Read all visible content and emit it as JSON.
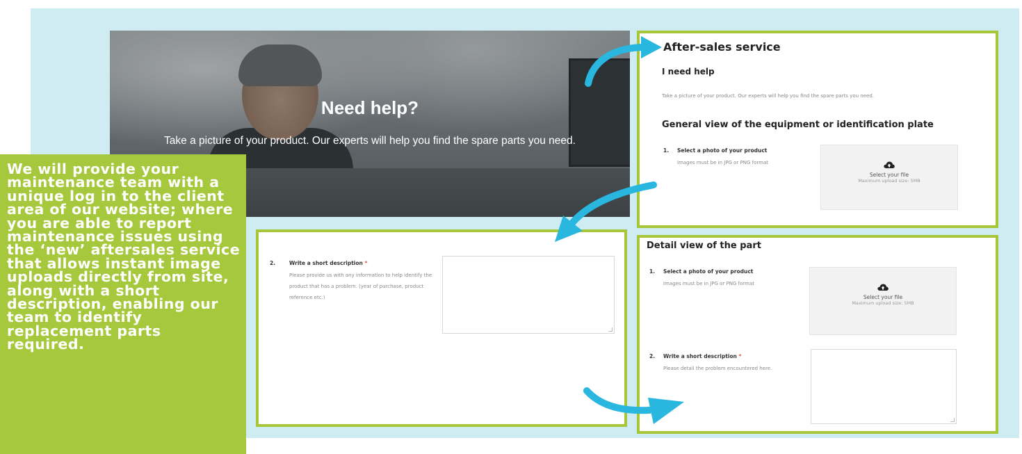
{
  "hero": {
    "title": "Need help?",
    "subtitle": "Take a picture of your product. Our experts will help you find the spare parts you need."
  },
  "panel_top": {
    "title": "After-sales service",
    "subtitle": "I need help",
    "intro": "Take a picture of your product. Our experts will help you find the spare parts you need.",
    "section": "General view of the equipment or identification plate",
    "step_number": "1.",
    "step_label": "Select a photo of your product",
    "step_hint": "Images must be in JPG or PNG format",
    "upload_label": "Select your file",
    "upload_limit": "Maximum upload size: 5MB"
  },
  "panel_left": {
    "step_number": "2.",
    "step_label": "Write a short description",
    "required_mark": "*",
    "hint": "Please provide us with any information to help identify the product that has a problem. (year of purchase, product reference etc.)"
  },
  "panel_bottom": {
    "section": "Detail view of the part",
    "step1_number": "1.",
    "step1_label": "Select a photo of your product",
    "step1_hint": "Images must be in JPG or PNG format",
    "upload_label": "Select your file",
    "upload_limit": "Maximum upload size: 5MB",
    "step2_number": "2.",
    "step2_label": "Write a short description",
    "required_mark": "*",
    "step2_hint": "Please detail the problem encountered here."
  },
  "callout": {
    "text": "We will provide your maintenance team with a unique log in to the client area of our website; where you are able to report maintenance issues using the ‘new’ aftersales service that allows instant image uploads directly from site, along with a short description, enabling our team to identify replacement parts required."
  },
  "colors": {
    "background": "#cfecf2",
    "accent_green": "#a6c83c",
    "arrow_blue": "#29b6df"
  }
}
